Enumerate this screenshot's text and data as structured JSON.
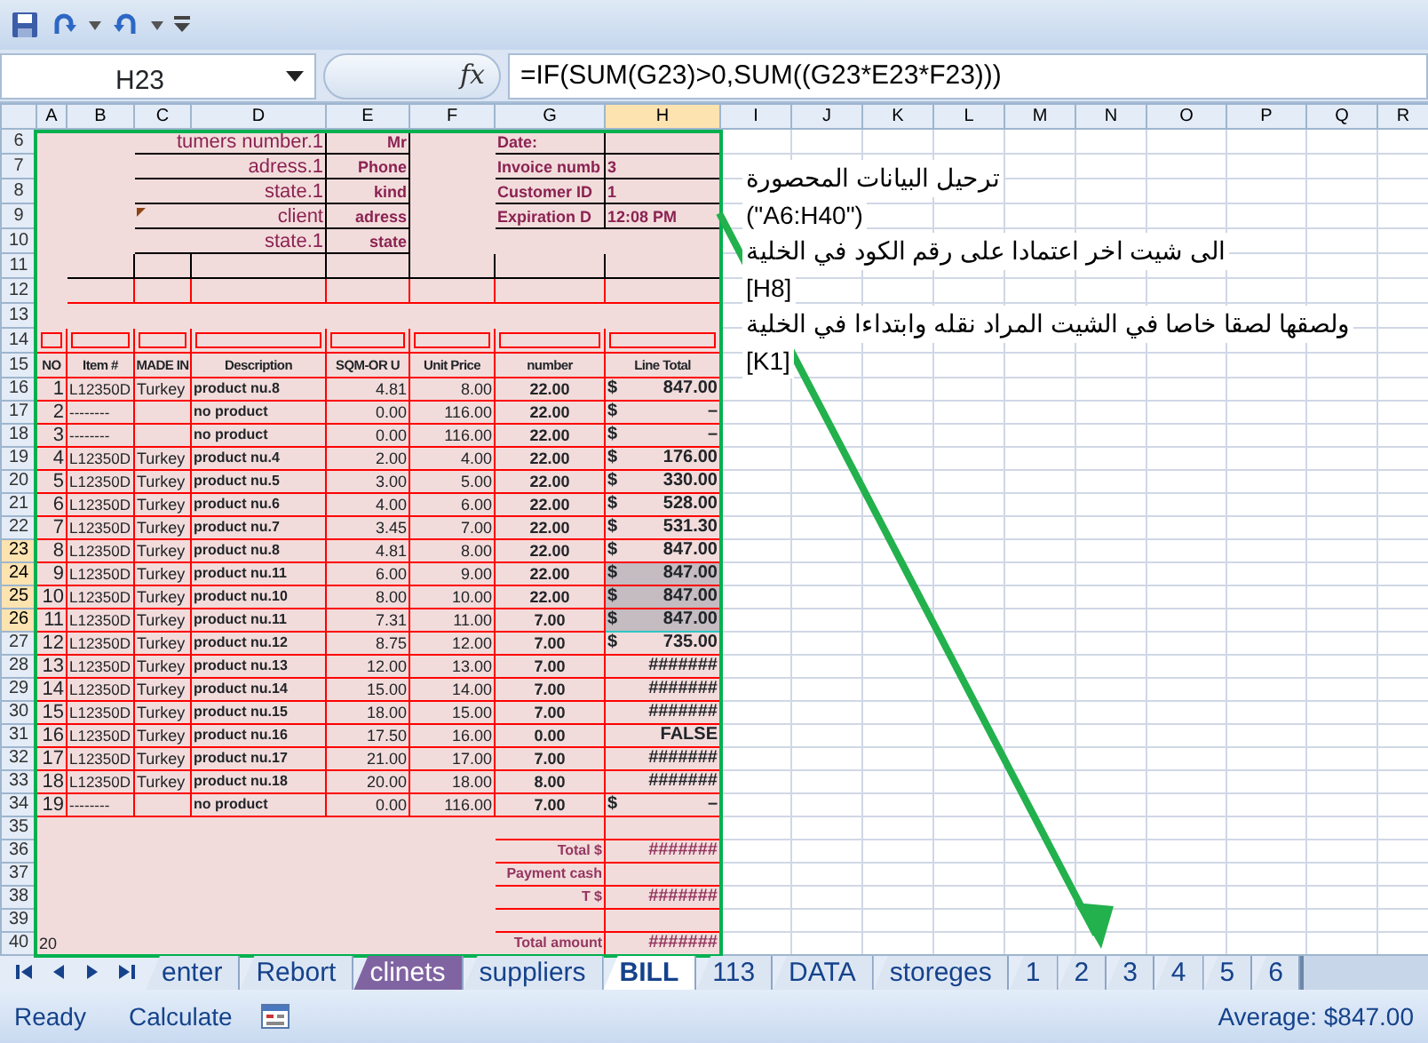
{
  "name_box": {
    "value": "H23"
  },
  "insert_function": {
    "label": "fx"
  },
  "formula_bar": {
    "value": "=IF(SUM(G23)>0,SUM((G23*E23*F23)))"
  },
  "columns": [
    {
      "label": "A",
      "selected": false
    },
    {
      "label": "B",
      "selected": false
    },
    {
      "label": "C",
      "selected": false
    },
    {
      "label": "D",
      "selected": false
    },
    {
      "label": "E",
      "selected": false
    },
    {
      "label": "F",
      "selected": false
    },
    {
      "label": "G",
      "selected": false
    },
    {
      "label": "H",
      "selected": true
    },
    {
      "label": "I",
      "selected": false
    },
    {
      "label": "J",
      "selected": false
    },
    {
      "label": "K",
      "selected": false
    },
    {
      "label": "L",
      "selected": false
    },
    {
      "label": "M",
      "selected": false
    },
    {
      "label": "N",
      "selected": false
    },
    {
      "label": "O",
      "selected": false
    },
    {
      "label": "P",
      "selected": false
    },
    {
      "label": "Q",
      "selected": false
    },
    {
      "label": "R",
      "selected": false
    }
  ],
  "rows": [
    {
      "row": "6",
      "kind": "info",
      "selected": false,
      "comment": false,
      "c": "tumers number.1",
      "e": "Mr",
      "g": "Date:"
    },
    {
      "row": "7",
      "kind": "info",
      "selected": false,
      "comment": false,
      "c": "adress.1",
      "e": "Phone",
      "g": "Invoice numb",
      "h": "3"
    },
    {
      "row": "8",
      "kind": "info",
      "selected": false,
      "comment": false,
      "c": "state.1",
      "e": "kind",
      "g": "Customer ID",
      "h": "1"
    },
    {
      "row": "9",
      "kind": "info",
      "selected": false,
      "comment": true,
      "c": "client",
      "e": "adress",
      "g": "Expiration D",
      "h": "12:08 PM"
    },
    {
      "row": "10",
      "kind": "info",
      "selected": false,
      "comment": false,
      "c": "state.1",
      "e": "state"
    },
    {
      "row": "11",
      "kind": "grid-black",
      "selected": false
    },
    {
      "row": "12",
      "kind": "grid-red",
      "selected": false
    },
    {
      "row": "13",
      "kind": "empty",
      "selected": false
    },
    {
      "row": "14",
      "kind": "boxed",
      "selected": false
    },
    {
      "row": "15",
      "kind": "heading",
      "selected": false,
      "cells": [
        "NO",
        "Item #",
        "MADE IN",
        "Description",
        "SQM-OR U",
        "Unit Price",
        "number",
        "Line Total"
      ]
    },
    {
      "row": "16",
      "kind": "item",
      "selected": false,
      "no": "1",
      "item": "L12350D",
      "made_in": "Turkey",
      "description": "product nu.8",
      "sqm": "4.81",
      "unit_price": "8.00",
      "number": "22.00",
      "currency": "$",
      "total": "847.00"
    },
    {
      "row": "17",
      "kind": "item",
      "selected": false,
      "no": "2",
      "item": "--------",
      "description": "no product",
      "sqm": "0.00",
      "unit_price": "116.00",
      "number": "22.00",
      "currency": "$",
      "total": "–"
    },
    {
      "row": "18",
      "kind": "item",
      "selected": false,
      "no": "3",
      "item": "--------",
      "description": "no product",
      "sqm": "0.00",
      "unit_price": "116.00",
      "number": "22.00",
      "currency": "$",
      "total": "–"
    },
    {
      "row": "19",
      "kind": "item",
      "selected": false,
      "no": "4",
      "item": "L12350D",
      "made_in": "Turkey",
      "description": "product nu.4",
      "sqm": "2.00",
      "unit_price": "4.00",
      "number": "22.00",
      "currency": "$",
      "total": "176.00"
    },
    {
      "row": "20",
      "kind": "item",
      "selected": false,
      "no": "5",
      "item": "L12350D",
      "made_in": "Turkey",
      "description": "product nu.5",
      "sqm": "3.00",
      "unit_price": "5.00",
      "number": "22.00",
      "currency": "$",
      "total": "330.00"
    },
    {
      "row": "21",
      "kind": "item",
      "selected": false,
      "no": "6",
      "item": "L12350D",
      "made_in": "Turkey",
      "description": "product nu.6",
      "sqm": "4.00",
      "unit_price": "6.00",
      "number": "22.00",
      "currency": "$",
      "total": "528.00"
    },
    {
      "row": "22",
      "kind": "item",
      "selected": false,
      "no": "7",
      "item": "L12350D",
      "made_in": "Turkey",
      "description": "product nu.7",
      "sqm": "3.45",
      "unit_price": "7.00",
      "number": "22.00",
      "currency": "$",
      "total": "531.30"
    },
    {
      "row": "23",
      "kind": "item",
      "selected": true,
      "active": true,
      "no": "8",
      "item": "L12350D",
      "made_in": "Turkey",
      "description": "product nu.8",
      "sqm": "4.81",
      "unit_price": "8.00",
      "number": "22.00",
      "currency": "$",
      "total": "847.00"
    },
    {
      "row": "24",
      "kind": "item",
      "selected": true,
      "active": false,
      "no": "9",
      "item": "L12350D",
      "made_in": "Turkey",
      "description": "product nu.11",
      "sqm": "6.00",
      "unit_price": "9.00",
      "number": "22.00",
      "currency": "$",
      "total": "847.00"
    },
    {
      "row": "25",
      "kind": "item",
      "selected": true,
      "active": false,
      "no": "10",
      "item": "L12350D",
      "made_in": "Turkey",
      "description": "product nu.10",
      "sqm": "8.00",
      "unit_price": "10.00",
      "number": "22.00",
      "currency": "$",
      "total": "847.00"
    },
    {
      "row": "26",
      "kind": "item",
      "selected": true,
      "active": false,
      "no": "11",
      "item": "L12350D",
      "made_in": "Turkey",
      "description": "product nu.11",
      "sqm": "7.31",
      "unit_price": "11.00",
      "number": "7.00",
      "currency": "$",
      "total": "847.00"
    },
    {
      "row": "27",
      "kind": "item",
      "selected": false,
      "no": "12",
      "item": "L12350D",
      "made_in": "Turkey",
      "description": "product nu.12",
      "sqm": "8.75",
      "unit_price": "12.00",
      "number": "7.00",
      "currency": "$",
      "total": "735.00"
    },
    {
      "row": "28",
      "kind": "item",
      "selected": false,
      "no": "13",
      "item": "L12350D",
      "made_in": "Turkey",
      "description": "product nu.13",
      "sqm": "12.00",
      "unit_price": "13.00",
      "number": "7.00",
      "total": "#######"
    },
    {
      "row": "29",
      "kind": "item",
      "selected": false,
      "no": "14",
      "item": "L12350D",
      "made_in": "Turkey",
      "description": "product nu.14",
      "sqm": "15.00",
      "unit_price": "14.00",
      "number": "7.00",
      "total": "#######"
    },
    {
      "row": "30",
      "kind": "item",
      "selected": false,
      "no": "15",
      "item": "L12350D",
      "made_in": "Turkey",
      "description": "product nu.15",
      "sqm": "18.00",
      "unit_price": "15.00",
      "number": "7.00",
      "total": "#######"
    },
    {
      "row": "31",
      "kind": "item",
      "selected": false,
      "no": "16",
      "item": "L12350D",
      "made_in": "Turkey",
      "description": "product nu.16",
      "sqm": "17.50",
      "unit_price": "16.00",
      "number": "0.00",
      "total": "FALSE"
    },
    {
      "row": "32",
      "kind": "item",
      "selected": false,
      "no": "17",
      "item": "L12350D",
      "made_in": "Turkey",
      "description": "product nu.17",
      "sqm": "21.00",
      "unit_price": "17.00",
      "number": "7.00",
      "total": "#######"
    },
    {
      "row": "33",
      "kind": "item",
      "selected": false,
      "no": "18",
      "item": "L12350D",
      "made_in": "Turkey",
      "description": "product nu.18",
      "sqm": "20.00",
      "unit_price": "18.00",
      "number": "8.00",
      "total": "#######"
    },
    {
      "row": "34",
      "kind": "item",
      "selected": false,
      "no": "19",
      "item": "--------",
      "description": "no product",
      "sqm": "0.00",
      "unit_price": "116.00",
      "number": "7.00",
      "currency": "$",
      "total": "–"
    },
    {
      "row": "35",
      "kind": "total",
      "selected": false
    },
    {
      "row": "36",
      "kind": "total",
      "selected": false,
      "g": "Total $",
      "h": "#######"
    },
    {
      "row": "37",
      "kind": "total",
      "selected": false,
      "g": "Payment cash"
    },
    {
      "row": "38",
      "kind": "total",
      "selected": false,
      "g": "T $",
      "h": "#######"
    },
    {
      "row": "39",
      "kind": "total",
      "selected": false
    },
    {
      "row": "40",
      "kind": "total",
      "selected": false,
      "a": "20",
      "g": "Total amount",
      "h": "#######"
    }
  ],
  "note_lines": [
    "ترحيل البيانات المحصورة",
    "(\"A6:H40\")",
    "الى شيت اخر اعتمادا على رقم الكود في الخلية",
    "[H8]",
    "ولصقها لصقا خاصا في الشيت المراد نقله وابتداءا في الخلية",
    "[K1]"
  ],
  "sheet_tabs": [
    {
      "label": "enter",
      "selected": false
    },
    {
      "label": "Rebort",
      "selected": false
    },
    {
      "label": "clinets",
      "selected": false,
      "color": "#8064a2"
    },
    {
      "label": "suppliers",
      "selected": false
    },
    {
      "label": "BILL",
      "selected": true
    },
    {
      "label": "113",
      "selected": false
    },
    {
      "label": "DATA",
      "selected": false
    },
    {
      "label": "storeges",
      "selected": false
    },
    {
      "label": "1",
      "selected": false
    },
    {
      "label": "2",
      "selected": false
    },
    {
      "label": "3",
      "selected": false
    },
    {
      "label": "4",
      "selected": false
    },
    {
      "label": "5",
      "selected": false
    },
    {
      "label": "6",
      "selected": false
    }
  ],
  "status_bar": {
    "mode": "Ready",
    "calc": "Calculate",
    "summary": "Average:  $847.00"
  }
}
